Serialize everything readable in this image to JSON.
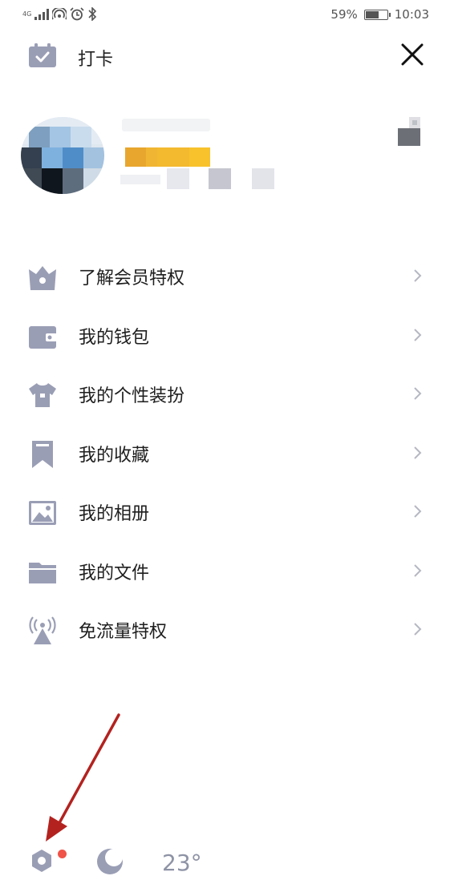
{
  "status_bar": {
    "network": "4G",
    "battery_percent_text": "59%",
    "battery_level": 0.59,
    "time": "10:03"
  },
  "header": {
    "checkin_label": "打卡",
    "close_icon": "close-icon",
    "checkin_icon": "calendar-check-icon"
  },
  "profile": {
    "avatar_icon": "avatar",
    "qr_icon": "qr-code-icon",
    "vip_colors": [
      "#e8a62e",
      "#f3b92f",
      "#f8c22d"
    ]
  },
  "menu": {
    "items": [
      {
        "label": "了解会员特权",
        "icon": "crown-icon"
      },
      {
        "label": "我的钱包",
        "icon": "wallet-icon"
      },
      {
        "label": "我的个性装扮",
        "icon": "tshirt-icon"
      },
      {
        "label": "我的收藏",
        "icon": "bookmark-icon"
      },
      {
        "label": "我的相册",
        "icon": "photo-icon"
      },
      {
        "label": "我的文件",
        "icon": "folder-icon"
      },
      {
        "label": "免流量特权",
        "icon": "antenna-icon"
      }
    ]
  },
  "bottom_bar": {
    "temperature": "23°",
    "settings_icon": "settings-icon",
    "night_icon": "night-mode-icon"
  },
  "colors": {
    "icon_gray": "#9a9eb5",
    "chevron": "#b5b8c2",
    "annotation_arrow": "#b3221f",
    "badge_red": "#f05348"
  }
}
